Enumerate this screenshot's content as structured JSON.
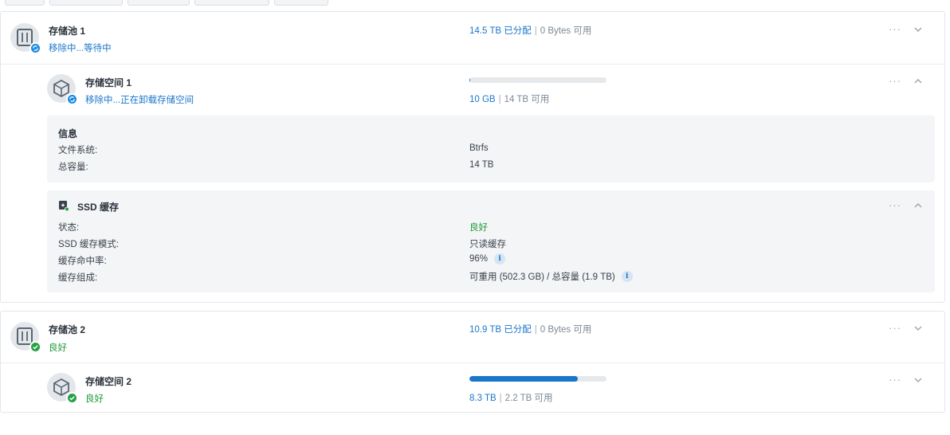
{
  "pool1": {
    "name": "存储池 1",
    "status": "移除中...等待中",
    "allocated": "14.5 TB 已分配",
    "available": "0 Bytes 可用",
    "more_label": "···"
  },
  "volume1": {
    "name": "存储空间 1",
    "status": "移除中...正在卸载存储空间",
    "used": "10 GB",
    "available": "14 TB 可用",
    "usage_fraction": 0.001,
    "more_label": "···"
  },
  "info_panel": {
    "heading": "信息",
    "rows": [
      {
        "label": "文件系统:",
        "value": "Btrfs"
      },
      {
        "label": "总容量:",
        "value": "14 TB"
      }
    ]
  },
  "ssd_panel": {
    "heading": "SSD 缓存",
    "more_label": "···",
    "rows": [
      {
        "label": "状态:",
        "value": "良好"
      },
      {
        "label": "SSD 缓存模式:",
        "value": "只读缓存"
      },
      {
        "label": "缓存命中率:",
        "value": "96%"
      },
      {
        "label": "缓存组成:",
        "value": "可重用 (502.3 GB) / 总容量 (1.9 TB)"
      }
    ],
    "info_icon_glyph": "i"
  },
  "pool2": {
    "name": "存储池 2",
    "status": "良好",
    "allocated": "10.9 TB 已分配",
    "available": "0 Bytes 可用",
    "more_label": "···"
  },
  "volume2": {
    "name": "存储空间 2",
    "status": "良好",
    "used": "8.3 TB",
    "available": "2.2 TB 可用",
    "usage_fraction": 0.79,
    "more_label": "···"
  },
  "separator": "|",
  "colors": {
    "accent": "#1a76c9",
    "good": "#1e9a36",
    "badge_blue": "#1a8ae0",
    "badge_green": "#26a046"
  },
  "icons": [
    "pool-icon",
    "volume-icon",
    "sync-badge-icon",
    "check-badge-icon",
    "ssd-cache-icon",
    "info-icon",
    "chevron-down-icon",
    "chevron-up-icon",
    "more-icon"
  ]
}
